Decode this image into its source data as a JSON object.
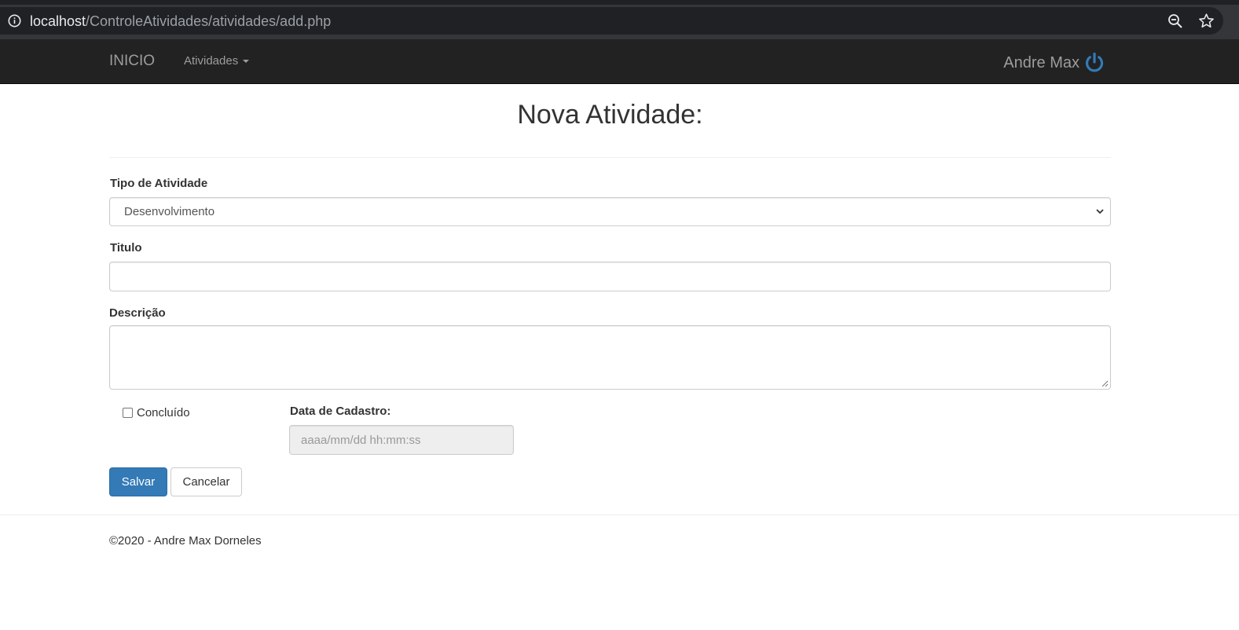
{
  "browser": {
    "url_host": "localhost",
    "url_path": "/ControleAtividades/atividades/add.php"
  },
  "navbar": {
    "brand": "INICIO",
    "menu_label": "Atividades",
    "user_name": "Andre Max",
    "accent_color": "#337ab7"
  },
  "form": {
    "title": "Nova Atividade:",
    "type_label": "Tipo de Atividade",
    "type_value": "Desenvolvimento",
    "title_label": "Titulo",
    "title_value": "",
    "description_label": "Descrição",
    "description_value": "",
    "done_label": "Concluído",
    "done_checked": false,
    "date_label": "Data de Cadastro:",
    "date_placeholder": "aaaa/mm/dd hh:mm:ss",
    "save_label": "Salvar",
    "cancel_label": "Cancelar"
  },
  "footer": {
    "text": "©2020 - Andre Max Dorneles"
  }
}
